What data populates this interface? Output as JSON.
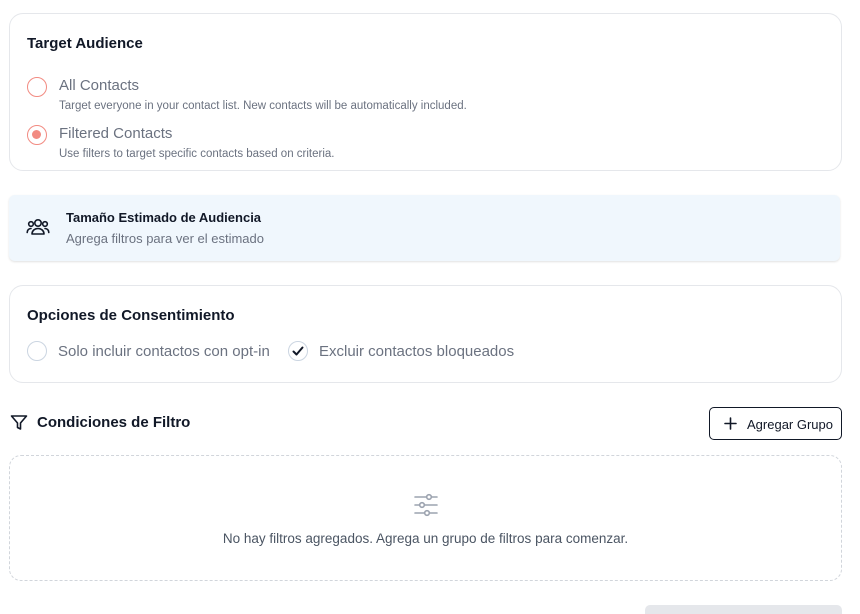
{
  "target_audience": {
    "title": "Target Audience",
    "options": [
      {
        "label": "All Contacts",
        "description": "Target everyone in your contact list. New contacts will be automatically included.",
        "selected": false
      },
      {
        "label": "Filtered Contacts",
        "description": "Use filters to target specific contacts based on criteria.",
        "selected": true
      }
    ]
  },
  "estimate": {
    "icon": "users-icon",
    "title": "Tamaño Estimado de Audiencia",
    "subtitle": "Agrega filtros para ver el estimado"
  },
  "consent": {
    "title": "Opciones de Consentimiento",
    "options": [
      {
        "label": "Solo incluir contactos con opt-in",
        "checked": false
      },
      {
        "label": "Excluir contactos bloqueados",
        "checked": true
      }
    ]
  },
  "filters": {
    "icon": "filter-icon",
    "title": "Condiciones de Filtro",
    "add_group_label": "Agregar Grupo",
    "empty_icon": "sliders-icon",
    "empty_text": "No hay filtros agregados. Agrega un grupo de filtros para comenzar."
  },
  "colors": {
    "accent": "#f28b82",
    "info_bg": "#f0f7fd",
    "border": "#e5e7eb",
    "muted_text": "#6b7280"
  }
}
